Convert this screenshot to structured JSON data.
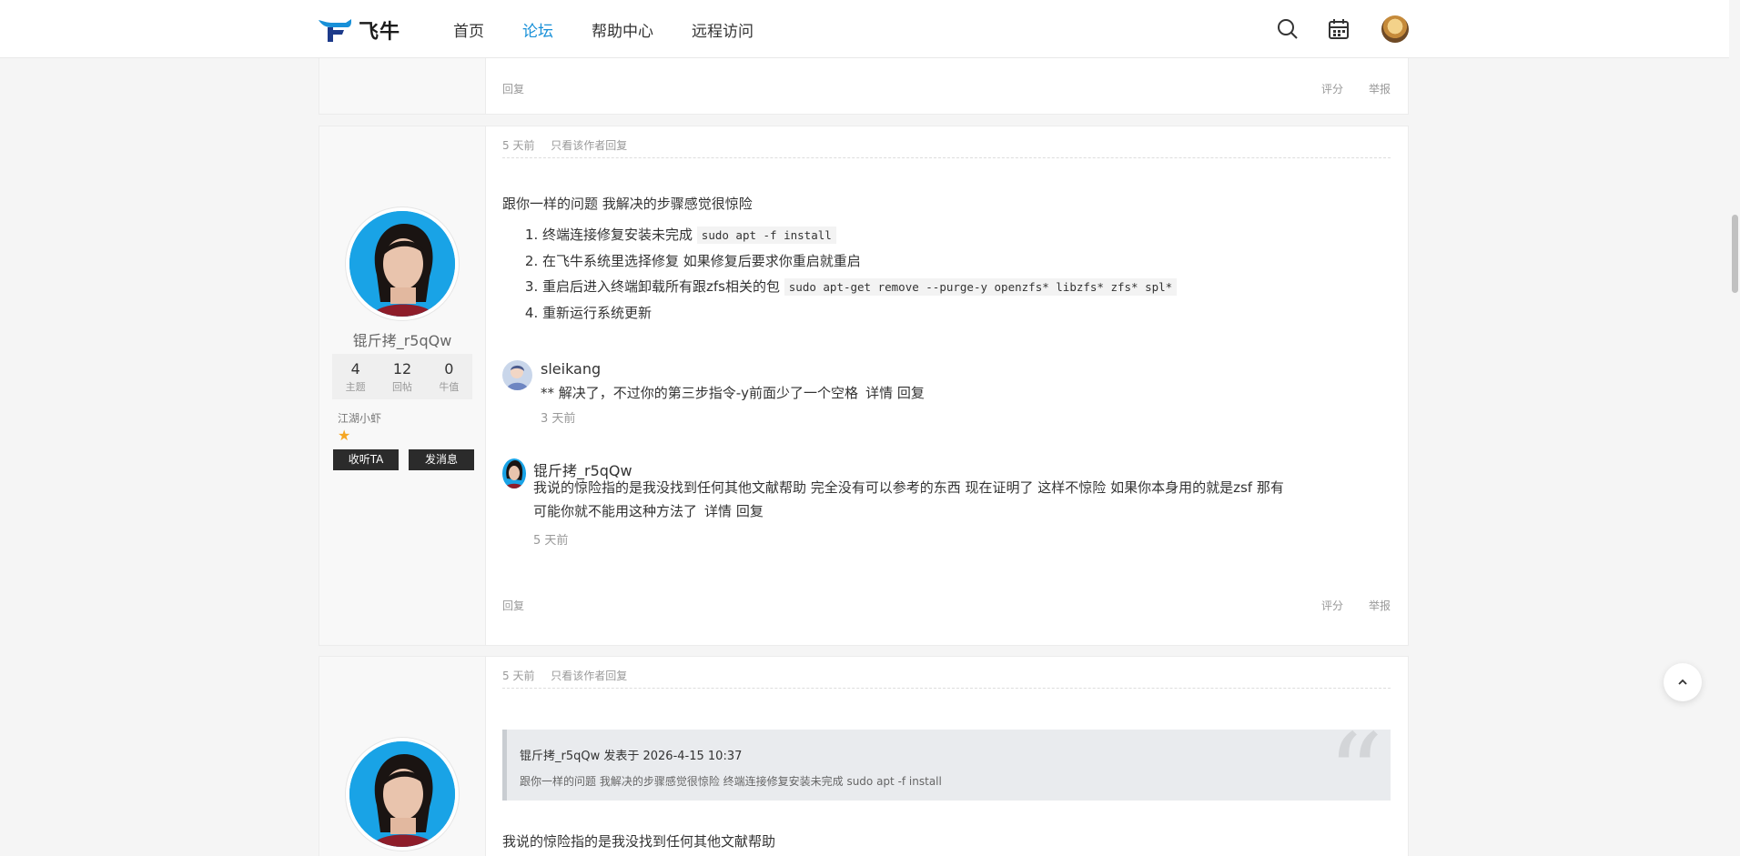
{
  "brand": {
    "name": "飞牛",
    "accent": "#1890d8"
  },
  "nav": {
    "items": [
      {
        "label": "首页",
        "active": false
      },
      {
        "label": "论坛",
        "active": true
      },
      {
        "label": "帮助中心",
        "active": false
      },
      {
        "label": "远程访问",
        "active": false
      }
    ]
  },
  "header_icons": [
    "search-icon",
    "calendar-icon",
    "user-avatar"
  ],
  "prev_post_footer": {
    "reply": "回复",
    "rate": "评分",
    "report": "举报"
  },
  "post1": {
    "time": "5 天前",
    "only_author": "只看该作者回复",
    "author": {
      "name": "锟斤拷_r5qQw",
      "stats": [
        {
          "value": "4",
          "label": "主题"
        },
        {
          "value": "12",
          "label": "回帖"
        },
        {
          "value": "0",
          "label": "牛值"
        }
      ],
      "rank": "江湖小虾",
      "follow": "收听TA",
      "message": "发消息"
    },
    "intro": "跟你一样的问题 我解决的步骤感觉很惊险",
    "steps": [
      {
        "text": "终端连接修复安装未完成",
        "code": "sudo apt -f install"
      },
      {
        "text": "在飞牛系统里选择修复 如果修复后要求你重启就重启",
        "code": ""
      },
      {
        "text": "重启后进入终端卸载所有跟zfs相关的包",
        "code": "sudo apt-get remove --purge-y openzfs* libzfs* zfs* spl*"
      },
      {
        "text": "重新运行系统更新",
        "code": ""
      }
    ],
    "comments": [
      {
        "name": "sleikang",
        "text": "** 解决了，不过你的第三步指令-y前面少了一个空格",
        "detail": "详情",
        "reply": "回复",
        "time": "3 天前"
      },
      {
        "name": "锟斤拷_r5qQw",
        "text_line1": "我说的惊险指的是我没找到任何其他文献帮助 完全没有可以参考的东西 现在证明了 这样不惊险 如果你本身用的就是zsf 那有",
        "text_line2": "可能你就不能用这种方法了",
        "detail": "详情",
        "reply": "回复",
        "time": "5 天前"
      }
    ],
    "footer": {
      "reply": "回复",
      "rate": "评分",
      "report": "举报"
    }
  },
  "post2": {
    "time": "5 天前",
    "only_author": "只看该作者回复",
    "quote": {
      "header": "锟斤拷_r5qQw 发表于 2026-4-15 10:37",
      "body": "跟你一样的问题 我解决的步骤感觉很惊险 终端连接修复安装未完成 sudo apt -f install"
    },
    "body_start": "我说的惊险指的是我没找到任何其他文献帮助"
  }
}
